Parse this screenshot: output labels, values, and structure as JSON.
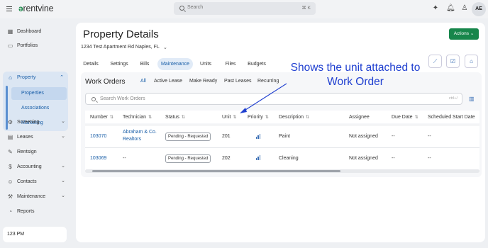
{
  "app": {
    "logo": "rentvine",
    "search_placeholder": "Search",
    "search_shortcut": "⌘ K",
    "avatar_initials": "AE"
  },
  "sidebar": {
    "items": [
      {
        "label": "Dashboard",
        "icon": "dashboard-icon"
      },
      {
        "label": "Portfolios",
        "icon": "portfolio-icon"
      },
      {
        "label": "Property",
        "icon": "home-icon"
      },
      {
        "label": "Screening",
        "icon": "screening-icon"
      },
      {
        "label": "Leases",
        "icon": "leases-icon"
      },
      {
        "label": "Rentsign",
        "icon": "rentsign-icon"
      },
      {
        "label": "Accounting",
        "icon": "dollar-icon"
      },
      {
        "label": "Contacts",
        "icon": "contacts-icon"
      },
      {
        "label": "Maintenance",
        "icon": "wrench-icon"
      },
      {
        "label": "Reports",
        "icon": "reports-icon"
      }
    ],
    "property_sub": [
      "Properties",
      "Associations",
      "Marketing"
    ],
    "clock": "123 PM"
  },
  "page": {
    "title": "Property Details",
    "address": "1234 Test Apartment Rd Naples, FL",
    "actions_label": "Actions",
    "tabs": [
      "Details",
      "Settings",
      "Bills",
      "Maintenance",
      "Units",
      "Files",
      "Budgets"
    ],
    "active_tab": "Maintenance"
  },
  "work_orders": {
    "title": "Work Orders",
    "subtabs": [
      "All",
      "Active Lease",
      "Make Ready",
      "Past Leases",
      "Recurring"
    ],
    "search_placeholder": "Search Work Orders",
    "search_kbd": "ctrl+/",
    "columns": [
      "Number",
      "Technician",
      "Status",
      "Unit",
      "Priority",
      "Description",
      "Assignee",
      "Due Date",
      "Scheduled Start Date"
    ],
    "rows": [
      {
        "number": "103070",
        "technician": "Abraham & Co. Realtors",
        "technician_l1": "Abraham & Co.",
        "technician_l2": "Realtors",
        "status": "Pending - Requested",
        "unit": "201",
        "description": "Paint",
        "assignee": "Not assigned",
        "due_date": "--",
        "start_date": "--"
      },
      {
        "number": "103069",
        "technician": "--",
        "technician_l1": "--",
        "technician_l2": "",
        "status": "Pending - Requested",
        "unit": "202",
        "description": "Cleaning",
        "assignee": "Not assigned",
        "due_date": "--",
        "start_date": "--"
      }
    ]
  },
  "annotation": {
    "line1": "Shows the unit attached to",
    "line2": "Work Order",
    "color": "#1f3fd0"
  },
  "colors": {
    "accent": "#1a5fa8",
    "action_green": "#17864b"
  }
}
